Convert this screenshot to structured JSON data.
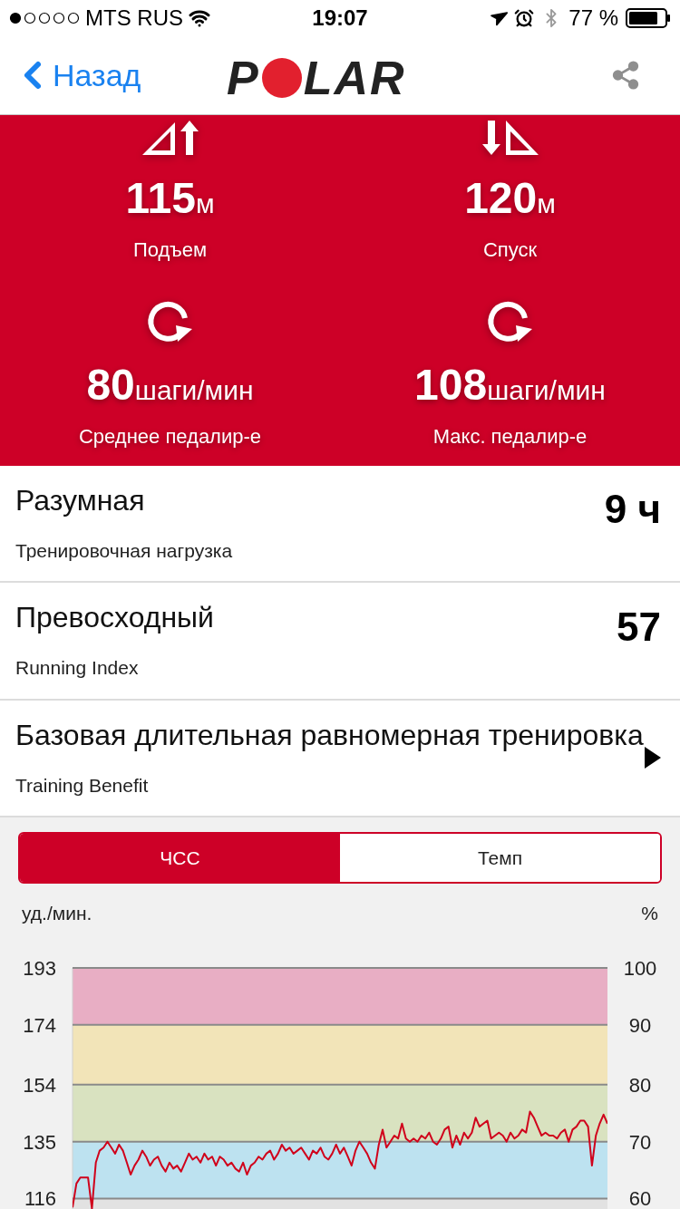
{
  "status_bar": {
    "carrier": "MTS RUS",
    "time": "19:07",
    "battery": "77 %"
  },
  "nav": {
    "back": "Назад",
    "logo": [
      "P",
      "LAR"
    ]
  },
  "stats": [
    {
      "kind": "ascent",
      "value": "115",
      "unit": "м",
      "label": "Подъем"
    },
    {
      "kind": "descent",
      "value": "120",
      "unit": "м",
      "label": "Спуск"
    },
    {
      "kind": "cadence",
      "value": "80",
      "unit": "шаги/мин",
      "label": "Среднее педалир-е"
    },
    {
      "kind": "cadence",
      "value": "108",
      "unit": "шаги/мин",
      "label": "Макс. педалир-е"
    }
  ],
  "rows": [
    {
      "kind": "value",
      "title": "Разумная",
      "subtitle": "Тренировочная нагрузка",
      "value": "9 ч"
    },
    {
      "kind": "value",
      "title": "Превосходный",
      "subtitle": "Running Index",
      "value": "57"
    },
    {
      "kind": "link",
      "title": "Базовая длительная равномерная тренировка",
      "subtitle": "Training Benefit"
    }
  ],
  "tabs": [
    {
      "label": "ЧСС",
      "selected": true
    },
    {
      "label": "Темп",
      "selected": false
    }
  ],
  "chart": {
    "right_unit": "%",
    "right_ticks": [
      "100",
      "90",
      "80",
      "70",
      "60"
    ],
    "chart_data": {
      "type": "line",
      "ylabel": "уд./мин.",
      "ylim": [
        112.5,
        193
      ],
      "yticks": [
        116,
        135,
        154,
        174,
        193
      ],
      "grid": true,
      "bands": [
        {
          "axis": "y",
          "from": 112.5,
          "to": 116,
          "color": "#e2e2e2"
        },
        {
          "axis": "y",
          "from": 116,
          "to": 135,
          "color": "#bde2f0"
        },
        {
          "axis": "y",
          "from": 135,
          "to": 154,
          "color": "#d9e2c0"
        },
        {
          "axis": "y",
          "from": 154,
          "to": 174,
          "color": "#f2e4b8"
        },
        {
          "axis": "y",
          "from": 174,
          "to": 193,
          "color": "#e8aec4"
        }
      ],
      "series": [
        {
          "color": "#d0021b",
          "values": [
            113,
            121,
            123,
            123,
            123,
            112.6,
            128,
            132,
            133,
            135,
            133,
            131,
            134,
            132,
            128,
            124,
            127,
            129,
            132,
            130,
            127,
            129,
            130,
            127,
            125,
            128,
            126,
            127,
            125,
            128,
            131,
            129,
            130,
            128,
            131,
            129,
            130,
            127,
            130,
            129,
            127,
            128,
            126,
            125,
            128,
            124,
            127,
            128,
            130,
            129,
            131,
            132,
            129,
            131,
            134,
            132,
            133,
            131,
            132,
            133,
            131,
            129,
            132,
            131,
            133,
            130,
            129,
            131,
            134,
            131,
            133,
            130,
            127,
            132,
            135,
            133,
            131,
            128,
            126,
            134,
            139,
            133,
            135,
            137,
            136,
            141,
            136,
            135,
            136,
            135,
            137,
            136,
            138,
            135,
            134,
            136,
            139,
            140,
            133,
            137,
            134,
            138,
            136,
            138,
            143,
            140,
            141,
            142,
            136,
            137,
            138,
            137,
            135,
            138,
            136,
            137,
            139,
            138,
            145,
            143,
            140,
            137,
            138,
            137,
            137,
            136,
            138,
            139,
            135,
            139,
            140,
            142,
            142,
            140,
            127,
            137,
            141,
            144,
            141
          ]
        }
      ]
    }
  }
}
